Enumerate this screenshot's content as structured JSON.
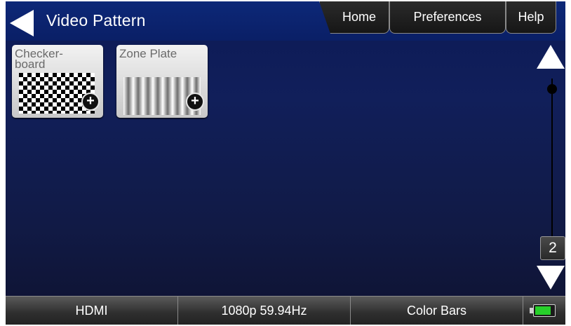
{
  "header": {
    "title": "Video Pattern",
    "tabs": [
      {
        "label": "Home"
      },
      {
        "label": "Preferences"
      },
      {
        "label": "Help"
      }
    ]
  },
  "patterns": [
    {
      "label_line1": "Checker-",
      "label_line2": "board",
      "icon": "checkerboard-thumbnail",
      "action_icon": "plus-icon",
      "action_symbol": "+"
    },
    {
      "label_line1": "Zone Plate",
      "label_line2": "",
      "icon": "zone-plate-thumbnail",
      "action_icon": "plus-icon",
      "action_symbol": "+"
    }
  ],
  "scroll": {
    "page_number": "2",
    "up_icon": "triangle-up-icon",
    "down_icon": "triangle-down-icon"
  },
  "status_bar": {
    "interface": "HDMI",
    "format": "1080p 59.94Hz",
    "pattern": "Color Bars",
    "battery_level": 0.85,
    "battery_color": "#27d02a"
  },
  "colors": {
    "background_top": "#0c1a57",
    "background_bottom": "#0e1230",
    "header": "#0d2878"
  }
}
